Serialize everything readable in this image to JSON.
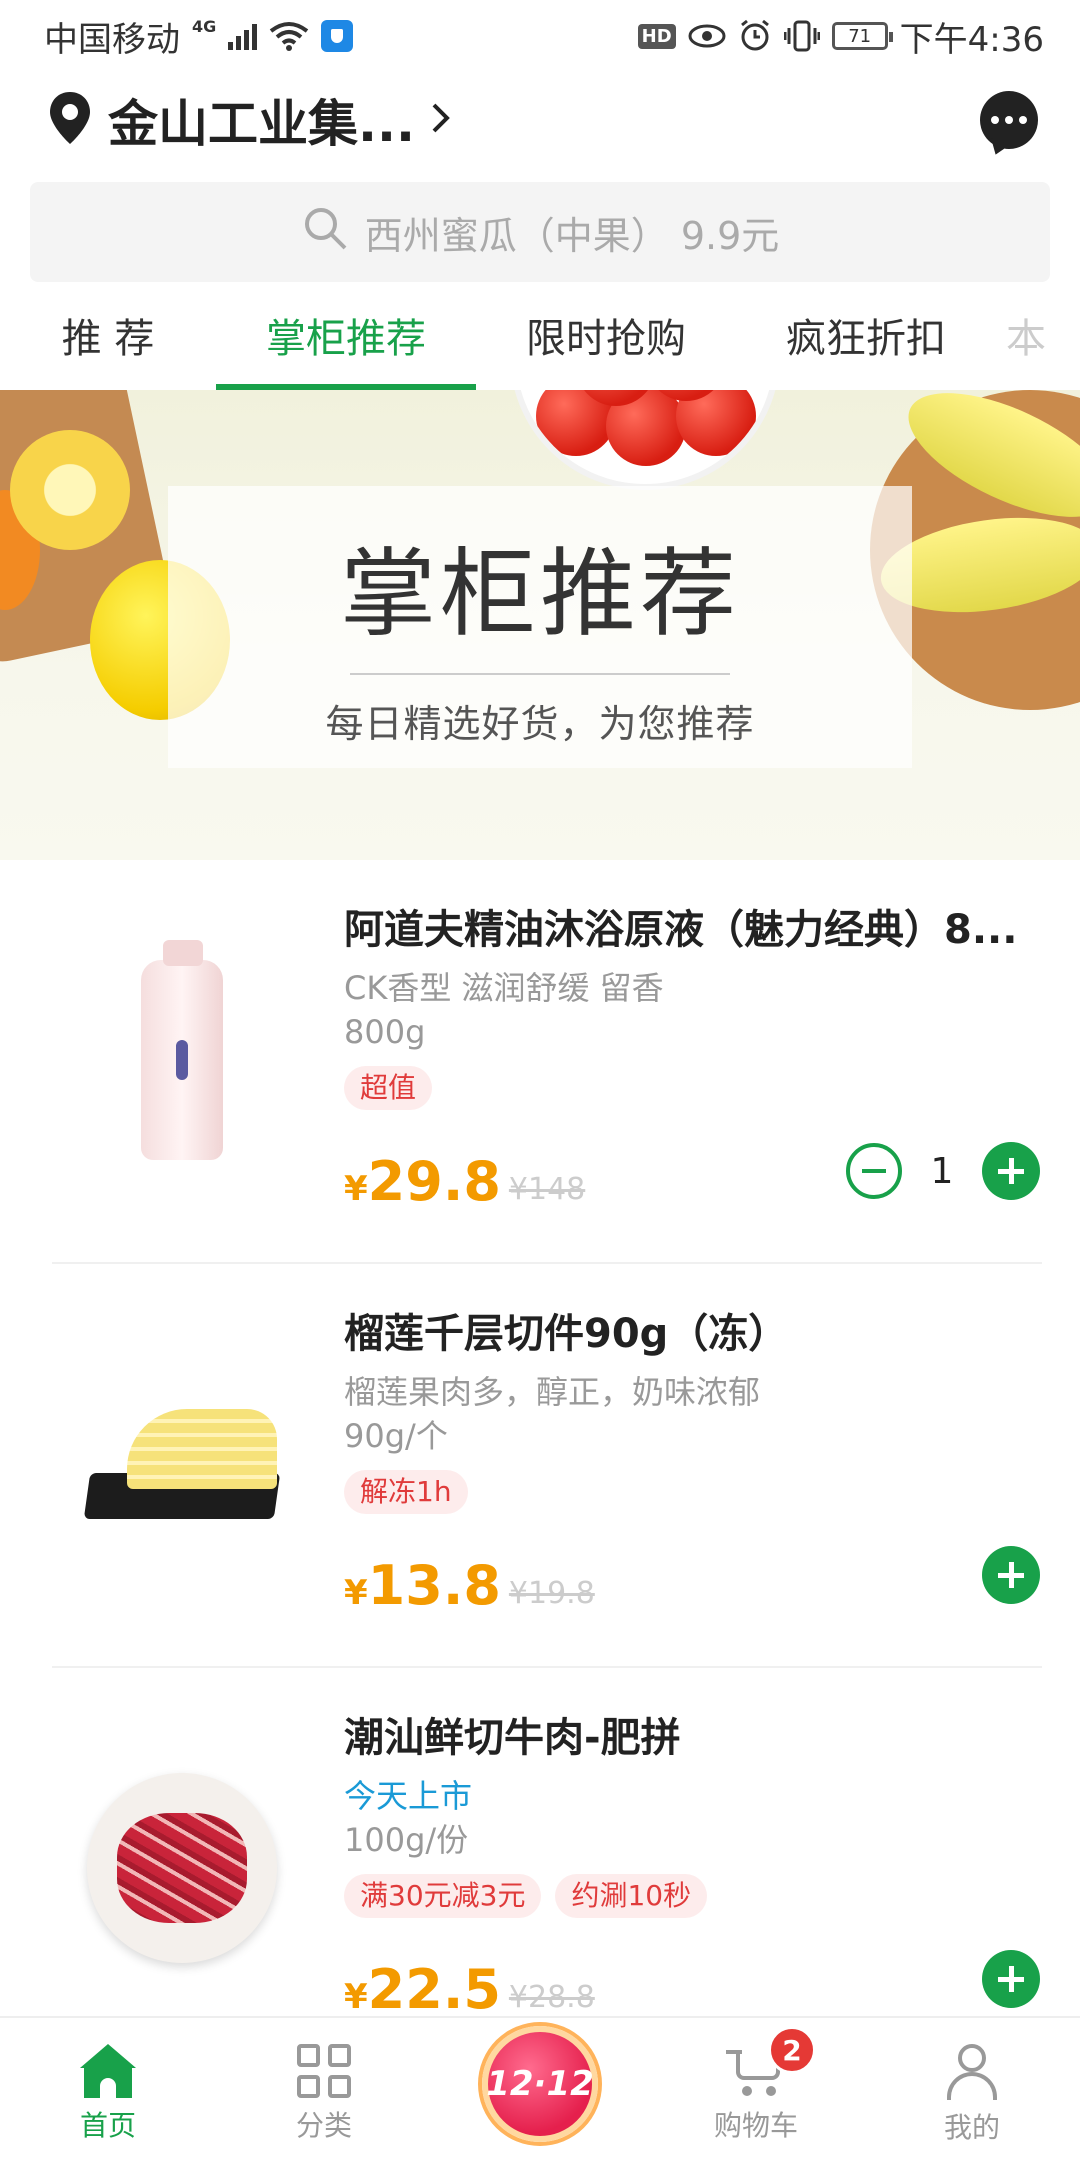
{
  "status_bar": {
    "carrier": "中国移动",
    "network": "4G",
    "battery": "71",
    "time": "下午4:36"
  },
  "header": {
    "location": "金山工业集...",
    "location_icon": "map-pin-icon",
    "chat_icon": "chat-icon"
  },
  "search": {
    "placeholder": "西州蜜瓜（中果） 9.9元"
  },
  "tabs": [
    {
      "label": "推 荐"
    },
    {
      "label": "掌柜推荐"
    },
    {
      "label": "限时抢购"
    },
    {
      "label": "疯狂折扣"
    },
    {
      "label": "本"
    }
  ],
  "banner": {
    "title": "掌柜推荐",
    "subtitle": "每日精选好货，为您推荐"
  },
  "products": [
    {
      "name": "阿道夫精油沐浴原液（魅力经典）8...",
      "desc": "CK香型  滋润舒缓   留香",
      "spec": "800g",
      "tags": [
        "超值"
      ],
      "currency": "¥",
      "price": "29.8",
      "original_price": "¥148",
      "qty": "1"
    },
    {
      "name": "榴莲千层切件90g（冻）",
      "desc": "榴莲果肉多，醇正，奶味浓郁",
      "spec": "90g/个",
      "tags": [
        "解冻1h"
      ],
      "currency": "¥",
      "price": "13.8",
      "original_price": "¥19.8"
    },
    {
      "name": "潮汕鲜切牛肉-肥拼",
      "desc": "今天上市",
      "spec": "100g/份",
      "tags": [
        "满30元减3元",
        "约涮10秒"
      ],
      "currency": "¥",
      "price": "22.5",
      "original_price": "¥28.8"
    }
  ],
  "bottom_nav": {
    "home": "首页",
    "category": "分类",
    "promo": "12·12",
    "cart": "购物车",
    "cart_count": "2",
    "mine": "我的"
  },
  "colors": {
    "accent": "#18a14a",
    "price": "#f39a00",
    "tag_text": "#e03b3b",
    "tag_bg": "#fdecec",
    "badge": "#e53935"
  }
}
